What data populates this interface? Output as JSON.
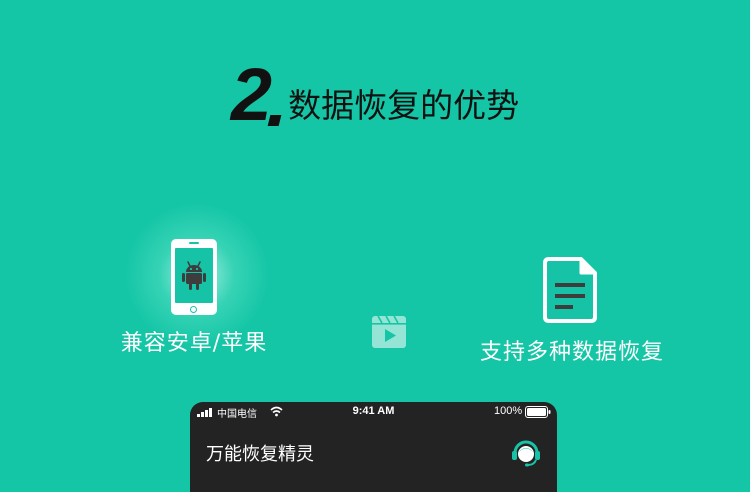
{
  "heading": {
    "number": "2",
    "text": "数据恢复的优势"
  },
  "features": [
    {
      "icon": "android-phone-icon",
      "label": "兼容安卓/苹果"
    },
    {
      "icon": "document-icon",
      "label": "支持多种数据恢复"
    }
  ],
  "center_icon": "video-icon",
  "phone_status": {
    "carrier": "中国电信",
    "time": "9:41 AM",
    "battery": "100%"
  },
  "app": {
    "title": "万能恢复精灵",
    "support_icon": "customer-service-icon"
  },
  "colors": {
    "background": "#14c6a6",
    "accent": "#17c3a7",
    "panel": "#232323",
    "heading": "#111111"
  }
}
